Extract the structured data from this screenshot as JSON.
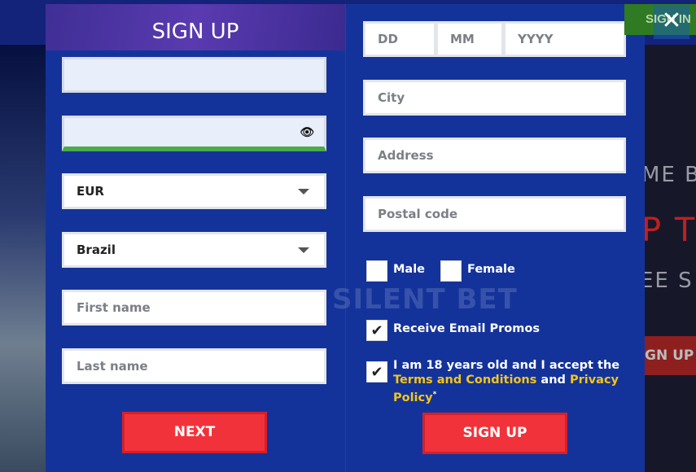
{
  "background": {
    "sign_in": "SIGN IN",
    "line1": "ME BO",
    "line2": "P TO",
    "line3": "EE S",
    "signup_btn": "GN UP"
  },
  "close_icon": "close-icon",
  "modal": {
    "title": "SIGN UP",
    "left": {
      "email_value": "",
      "password_value": "",
      "currency": "EUR",
      "country": "Brazil",
      "first_name_placeholder": "First name",
      "last_name_placeholder": "Last name",
      "next_label": "NEXT"
    },
    "right": {
      "dd": "DD",
      "mm": "MM",
      "yyyy": "YYYY",
      "city": "City",
      "address": "Address",
      "postal": "Postal code",
      "male": "Male",
      "female": "Female",
      "promos": "Receive Email Promos",
      "promos_checked": true,
      "terms_prefix": "I am 18 years old and I accept the ",
      "terms_link": "Terms and Conditions",
      "terms_mid": " and ",
      "privacy_link": "Privacy Policy",
      "terms_required": "*",
      "terms_checked": true,
      "signup_label": "SIGN UP"
    },
    "watermark": "SILENT BET"
  },
  "colors": {
    "accent": "#f2323a",
    "modal": "#14339a",
    "link": "#f5c518",
    "strength": "#4caa4c"
  }
}
